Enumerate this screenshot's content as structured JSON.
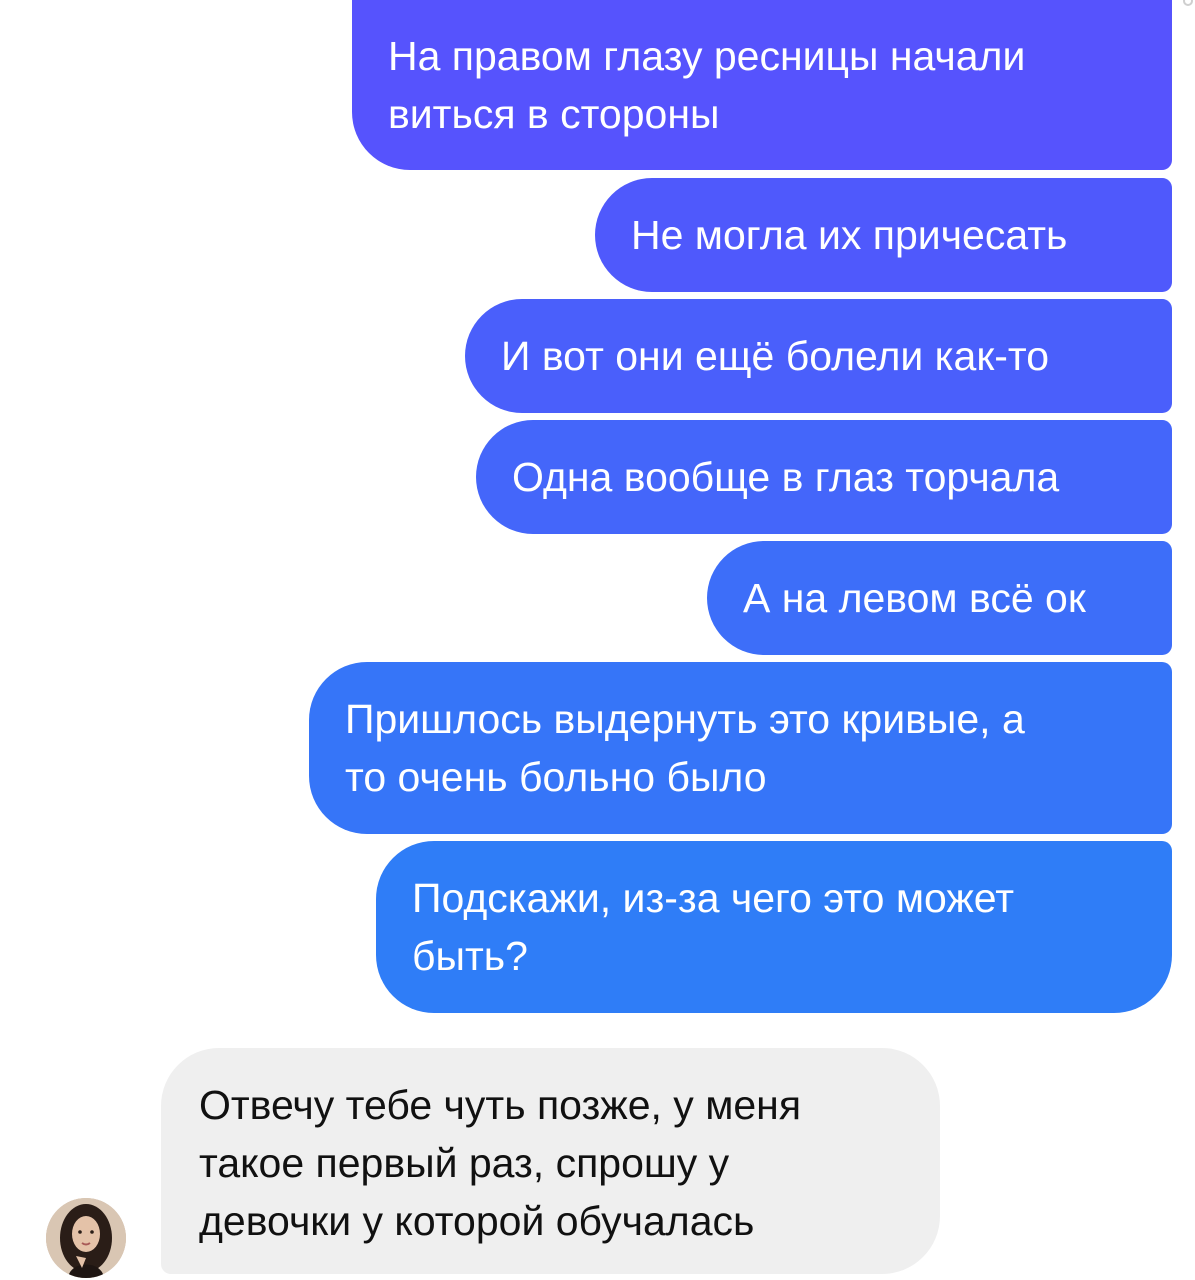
{
  "conversation": {
    "outgoing": [
      {
        "lines": [
          "На правом глазу ресницы начали",
          "виться в стороны"
        ]
      },
      {
        "lines": [
          "Не могла их причесать"
        ]
      },
      {
        "lines": [
          "И вот они ещё болели как-то"
        ]
      },
      {
        "lines": [
          "Одна вообще в глаз торчала"
        ]
      },
      {
        "lines": [
          "А на левом всё ок"
        ]
      },
      {
        "lines": [
          "Пришлось выдернуть это кривые, а",
          "то очень больно было"
        ]
      },
      {
        "lines": [
          "Подскажи, из-за чего это может",
          "быть?"
        ]
      }
    ],
    "incoming": [
      {
        "lines": [
          "Отвечу тебе чуть позже, у меня",
          "такое первый раз, спрошу у",
          "девочки у которой обучалась"
        ]
      }
    ]
  },
  "colors": {
    "outgoing_gradient_top": "#5653fd",
    "outgoing_gradient_bottom": "#2f7df7",
    "incoming_bubble": "#efefef",
    "incoming_text": "#111111"
  },
  "icons": {
    "sender_avatar": "user-avatar-photo"
  }
}
